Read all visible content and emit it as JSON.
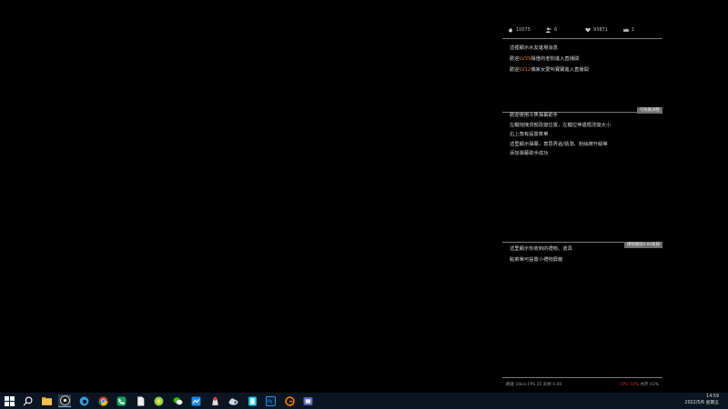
{
  "stats": {
    "fire": "10075",
    "fans": "6",
    "likes": "93871",
    "crown": "1"
  },
  "welcome": {
    "intro": "這裡顯示水友進場消息",
    "lines": [
      {
        "pre": "歡迎",
        "level": "LV35",
        "post": "陽燈的老狗進入直播間"
      },
      {
        "pre": "歡迎",
        "level": "LV12",
        "post": "偶家女愛叫寶寶進入直播間"
      }
    ]
  },
  "assistant": {
    "tag": "可拖動調整",
    "lines": [
      "歡迎使用斗魚彈幕助手",
      "左鍵拖拽頂部改變位置，左鍵拉伸邊框改變大小",
      "右上角有設置菜單",
      "這里顯示彈幕，意思弄過/猜測、粉絲牌升級等",
      "添加彈幕助手成功"
    ]
  },
  "gifts": {
    "tag": "禮物總值0.00魚翅",
    "lines": [
      "這里顯示你收到的禮物、道具",
      "點菜單可設置小禮物屏蔽"
    ]
  },
  "bottombar": {
    "left": "網速 16k/s  FPS 35  丟幀 0.00",
    "cpu": "CPU 10%",
    "mem": "內存 43%"
  },
  "tray": {
    "time": "14:59",
    "date": "2022/5/6 星期五"
  },
  "taskbar": {
    "items": [
      {
        "name": "start-icon"
      },
      {
        "name": "search-icon"
      },
      {
        "name": "file-explorer-icon"
      },
      {
        "name": "obs-icon"
      },
      {
        "name": "edge-icon"
      },
      {
        "name": "chrome-icon"
      },
      {
        "name": "phone-app-icon"
      },
      {
        "name": "document-icon"
      },
      {
        "name": "green-app-icon"
      },
      {
        "name": "wechat-icon"
      },
      {
        "name": "blue-app-icon"
      },
      {
        "name": "red-app-icon"
      },
      {
        "name": "cloud-app-icon"
      },
      {
        "name": "teal-app-icon"
      },
      {
        "name": "photoshop-icon"
      },
      {
        "name": "orange-app-icon"
      },
      {
        "name": "purple-app-icon"
      }
    ]
  },
  "colors": {
    "highlight": "#e07a2e",
    "taskbar": "#0b1522",
    "cpu_red": "#dd3333"
  }
}
